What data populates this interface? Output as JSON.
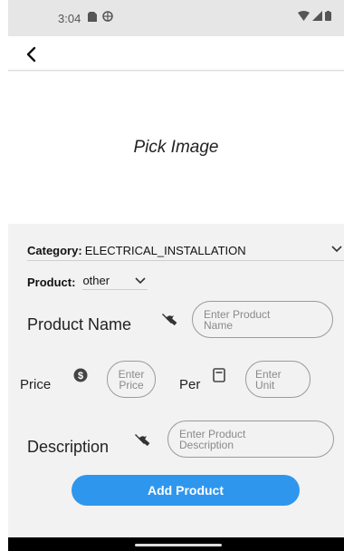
{
  "status_bar": {
    "time": "3:04"
  },
  "image_picker": {
    "label": "Pick Image"
  },
  "category": {
    "label": "Category:",
    "value": "ELECTRICAL_INSTALLATION"
  },
  "product": {
    "label": "Product:",
    "value": "other"
  },
  "product_name": {
    "label": "Product Name",
    "placeholder": "Enter Product\nName"
  },
  "price": {
    "label": "Price",
    "placeholder": "Enter\nPrice",
    "per_label": "Per",
    "unit_placeholder": "Enter\nUnit"
  },
  "description": {
    "label": "Description",
    "placeholder": "Enter Product\nDescription"
  },
  "add_button": {
    "label": "Add Product"
  },
  "colors": {
    "accent": "#2f96ee",
    "background": "#f2f2f2"
  }
}
